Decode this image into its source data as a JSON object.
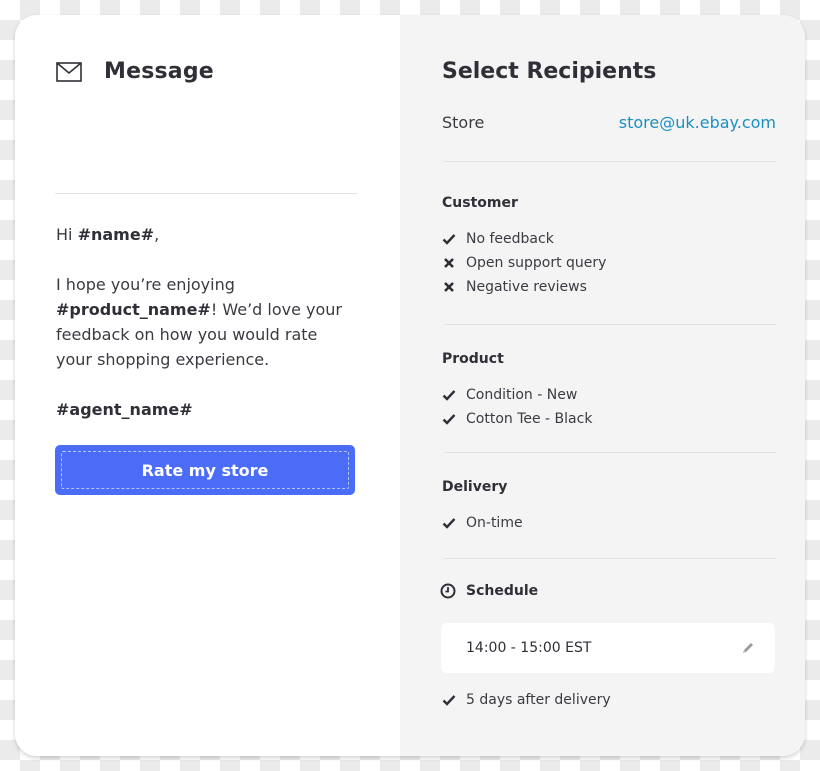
{
  "message": {
    "title": "Message",
    "icon": "mail-icon",
    "greeting_prefix": "Hi ",
    "greeting_var": "#name#",
    "greeting_suffix": ",",
    "body_prefix": "I hope you’re enjoying ",
    "body_var": "#product_name#",
    "body_suffix": "! We’d love your feedback on how you would rate your shopping experience.",
    "signature": "#agent_name#",
    "button_label": "Rate my store",
    "button_color": "#4a6cf7"
  },
  "recipients": {
    "title": "Select Recipients",
    "store_label": "Store",
    "store_email": "store@uk.ebay.com",
    "link_color": "#1a8fc3",
    "sections": [
      {
        "title": "Customer",
        "items": [
          {
            "label": "No feedback",
            "status": "check"
          },
          {
            "label": "Open support query",
            "status": "cross"
          },
          {
            "label": "Negative reviews",
            "status": "cross"
          }
        ]
      },
      {
        "title": "Product",
        "items": [
          {
            "label": "Condition - New",
            "status": "check"
          },
          {
            "label": "Cotton Tee - Black",
            "status": "check"
          }
        ]
      },
      {
        "title": "Delivery",
        "items": [
          {
            "label": "On-time",
            "status": "check"
          }
        ]
      }
    ],
    "schedule": {
      "title": "Schedule",
      "icon": "clock-icon",
      "time_range": "14:00 - 15:00 EST",
      "edit_icon": "pencil-icon",
      "items": [
        {
          "label": "5 days after delivery",
          "status": "check"
        }
      ]
    }
  }
}
